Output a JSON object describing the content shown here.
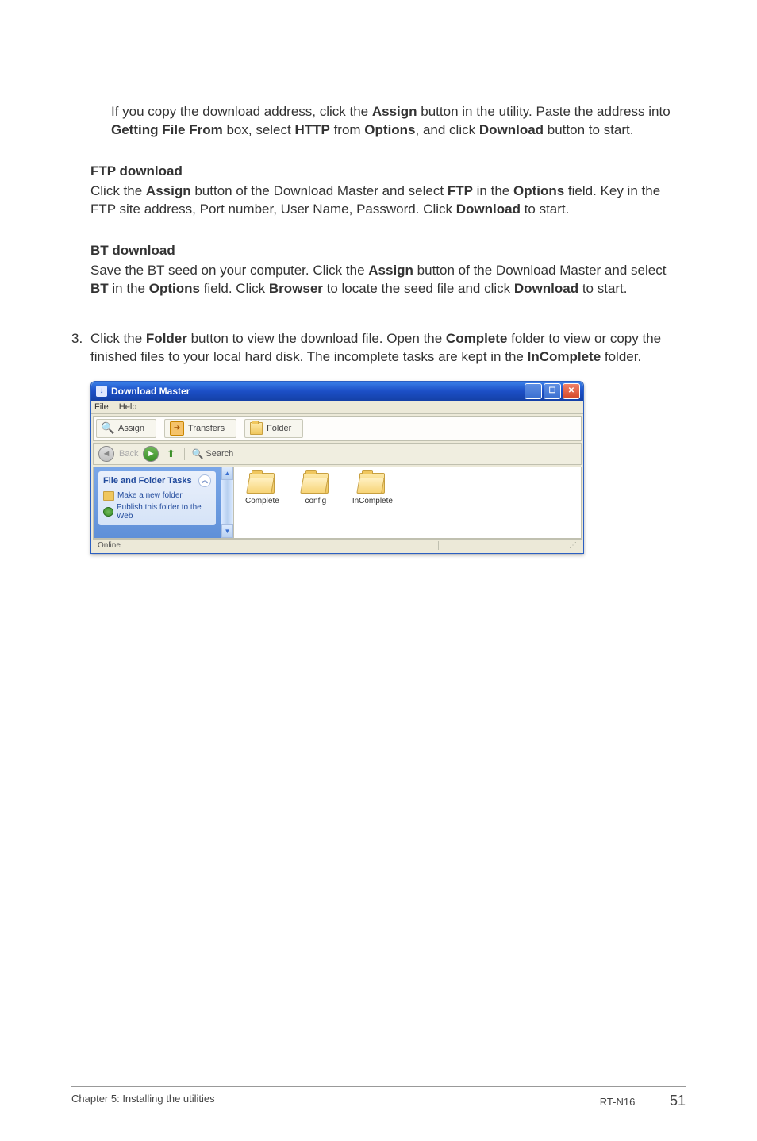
{
  "para_top": {
    "t1": "If you copy the download address, click the ",
    "assign": "Assign",
    "t2": " button in the utility. Paste the address into ",
    "getting": "Getting File From",
    "t3": " box, select ",
    "http": "HTTP",
    "t4": " from ",
    "options": "Options",
    "t5": ", and click ",
    "download": "Download",
    "t6": " button to start."
  },
  "ftp": {
    "heading": "FTP download",
    "t1": "Click the ",
    "assign": "Assign",
    "t2": " button of the Download Master and select ",
    "ftp": "FTP",
    "t3": " in the ",
    "options": "Options",
    "t4": " field. Key in the FTP site address, Port number, User Name, Password. Click ",
    "download": "Download",
    "t5": " to start."
  },
  "bt": {
    "heading": "BT download",
    "t1": "Save the BT seed on your computer. Click the ",
    "assign": "Assign",
    "t2": " button of the Download Master and select ",
    "bt": "BT",
    "t3": " in the ",
    "options": "Options",
    "t4": " field. Click ",
    "browser": "Browser",
    "t5": " to locate the seed file and click ",
    "download": "Download",
    "t6": " to start."
  },
  "step3": {
    "num": "3.",
    "t1": "Click the ",
    "folder": "Folder",
    "t2": " button to view the download file. Open the ",
    "complete": "Complete",
    "t3": " folder to view or copy the finished files to your local hard disk. The incomplete tasks are kept in the ",
    "incomplete": "InComplete",
    "t4": " folder."
  },
  "dm": {
    "title": "Download Master",
    "menu_file": "File",
    "menu_help": "Help",
    "tb_assign": "Assign",
    "tb_transfers": "Transfers",
    "tb_folder": "Folder",
    "nav_back": "Back",
    "nav_search": "Search",
    "side_head": "File and Folder Tasks",
    "side_link1": "Make a new folder",
    "side_link2": "Publish this folder to the Web",
    "folder_complete": "Complete",
    "folder_config": "config",
    "folder_incomplete": "InComplete",
    "status": "Online"
  },
  "footer": {
    "left": "Chapter 5: Installing the utilities",
    "right": "RT-N16",
    "page": "51"
  }
}
